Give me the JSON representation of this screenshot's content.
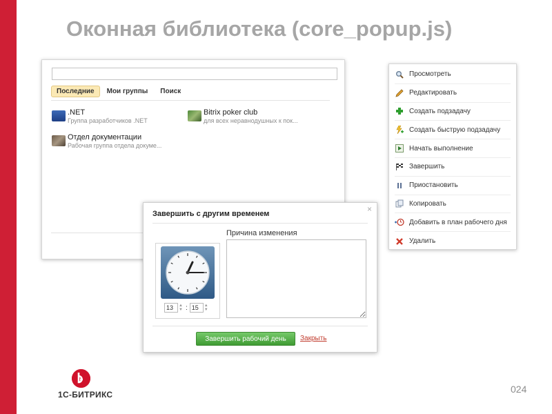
{
  "slide": {
    "title": "Оконная библиотека (core_popup.js)",
    "page_number": "024",
    "accent_color": "#cf1f35"
  },
  "social_popup": {
    "search_value": "",
    "tabs": [
      {
        "label": "Последние",
        "active": true
      },
      {
        "label": "Мои группы",
        "active": false
      },
      {
        "label": "Поиск",
        "active": false
      }
    ],
    "items": [
      {
        "name": ".NET",
        "desc": "Группа разработчиков .NET",
        "icon": "net-logo-icon"
      },
      {
        "name": "Bitrix poker club",
        "desc": "для всех неравнодушных к пок...",
        "icon": "poker-club-icon"
      },
      {
        "name": "Отдел документации",
        "desc": "Рабочая группа отдела докуме...",
        "icon": "documents-group-icon"
      }
    ]
  },
  "context_menu": {
    "items": [
      {
        "label": "Просмотреть",
        "icon": "magnifier-icon"
      },
      {
        "label": "Редактировать",
        "icon": "pencil-icon"
      },
      {
        "label": "Создать подзадачу",
        "icon": "plus-icon"
      },
      {
        "label": "Создать быструю подзадачу",
        "icon": "lightning-plus-icon"
      },
      {
        "label": "Начать выполнение",
        "icon": "play-icon"
      },
      {
        "label": "Завершить",
        "icon": "checkered-flag-icon"
      },
      {
        "label": "Приостановить",
        "icon": "pause-icon"
      },
      {
        "label": "Копировать",
        "icon": "copy-icon"
      },
      {
        "label": "Добавить в план рабочего дня",
        "icon": "add-to-plan-icon"
      },
      {
        "label": "Удалить",
        "icon": "delete-cross-icon"
      }
    ]
  },
  "dialog": {
    "title": "Завершить с другим временем",
    "close_glyph": "×",
    "hours": "13",
    "minutes": "15",
    "time_separator": ":",
    "reason_label": "Причина изменения",
    "reason_value": "",
    "primary_button": "Завершить рабочий день",
    "primary_color": "#4fae43",
    "close_link": "Закрыть"
  },
  "logo": {
    "text": "1С-БИТРИКС",
    "color": "#d0122b"
  }
}
